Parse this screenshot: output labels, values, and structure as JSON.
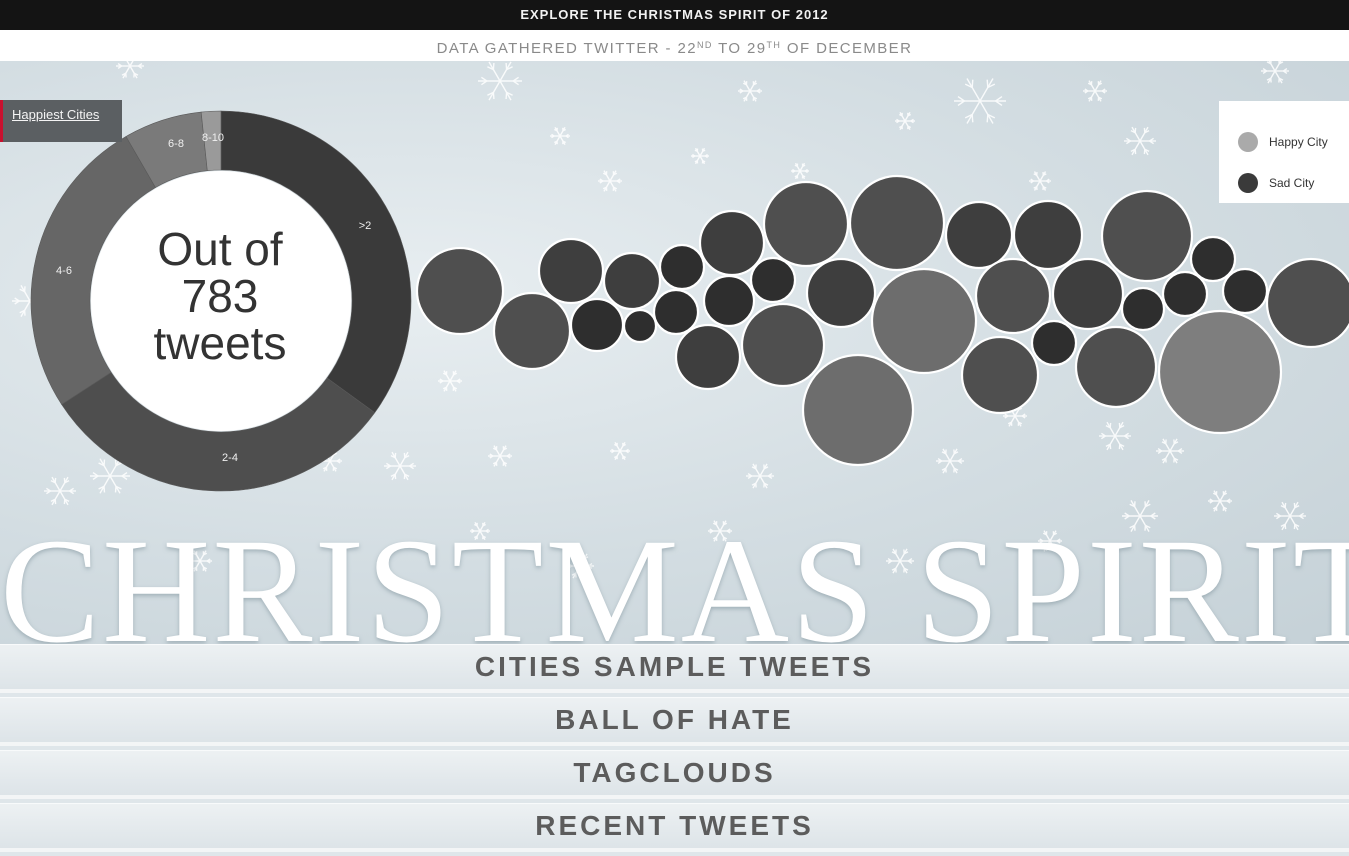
{
  "header": {
    "title": "EXPLORE THE CHRISTMAS SPIRIT OF 2012",
    "sub_prefix": "DATA GATHERED TWITTER - 22",
    "sub_sup1": "ND",
    "sub_mid": " TO 29",
    "sub_sup2": "TH",
    "sub_suffix": " OF DECEMBER"
  },
  "tab": {
    "label": "Happiest Cities"
  },
  "donut": {
    "center_line1": "Out of",
    "center_line2": "783",
    "center_line3": "tweets",
    "segments": [
      {
        "label": ">2",
        "color": "#3a3a3a"
      },
      {
        "label": "2-4",
        "color": "#4e4e4e"
      },
      {
        "label": "4-6",
        "color": "#666666"
      },
      {
        "label": "6-8",
        "color": "#7a7a7a"
      },
      {
        "label": "8-10",
        "color": "#9a9a9a"
      }
    ]
  },
  "legend": {
    "items": [
      {
        "label": "Happy City",
        "color": "#aaaaaa"
      },
      {
        "label": "Sad City",
        "color": "#3a3a3a"
      }
    ]
  },
  "bubbles": {
    "colors": {
      "dark": "#2e2e2e",
      "mid_dark": "#3e3e3e",
      "mid": "#4f4f4f",
      "light": "#6d6d6d",
      "lighter": "#7e7e7e"
    }
  },
  "big_title": "CHRISTMAS SPIRIT",
  "nav": {
    "items": [
      {
        "label": "CITIES SAMPLE TWEETS"
      },
      {
        "label": "BALL OF HATE"
      },
      {
        "label": "TAGCLOUDS"
      },
      {
        "label": "RECENT TWEETS"
      }
    ]
  }
}
